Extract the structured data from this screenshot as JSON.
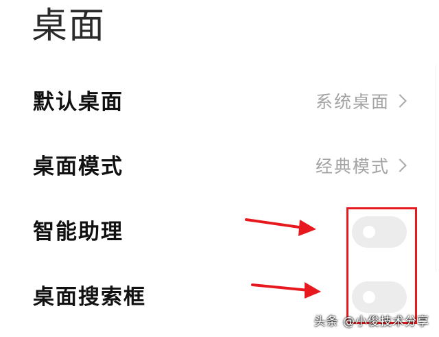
{
  "header": {
    "title": "桌面"
  },
  "settings": {
    "default_desktop": {
      "label": "默认桌面",
      "value": "系统桌面",
      "chevron_icon": "chevron-right-icon"
    },
    "desktop_mode": {
      "label": "桌面模式",
      "value": "经典模式",
      "chevron_icon": "chevron-right-icon"
    },
    "smart_assistant": {
      "label": "智能助理",
      "toggle_on": false
    },
    "desktop_search": {
      "label": "桌面搜索框",
      "toggle_on": false
    }
  },
  "annotations": {
    "highlight_color": "#e8191e",
    "arrow_color": "#e8191e"
  },
  "watermark": {
    "text": "头条 @小俊技术分享"
  },
  "colors": {
    "toggle_off_track": "#ececec",
    "value_text": "#a3a3a3"
  }
}
